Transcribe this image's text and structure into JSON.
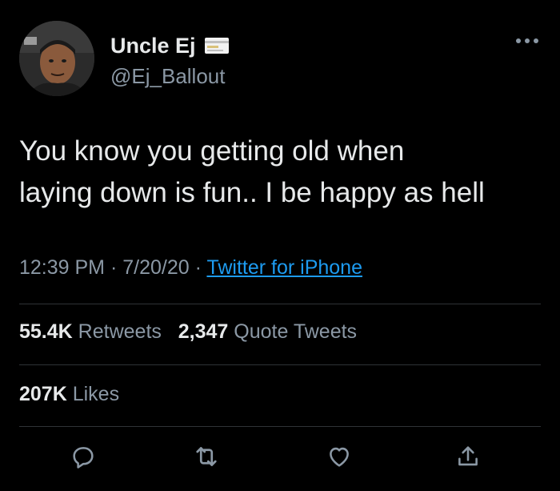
{
  "user": {
    "display_name": "Uncle Ej",
    "handle": "@Ej_Ballout",
    "badge_icon": "card-icon"
  },
  "tweet": {
    "text": "You know you getting old when\nlaying down is fun.. I be happy as hell",
    "time": "12:39 PM",
    "date": "7/20/20",
    "separator": "·",
    "source": "Twitter for iPhone"
  },
  "stats": {
    "retweets_count": "55.4K",
    "retweets_label": "Retweets",
    "quotes_count": "2,347",
    "quotes_label": "Quote Tweets",
    "likes_count": "207K",
    "likes_label": "Likes"
  },
  "actions": {
    "reply_icon": "reply-icon",
    "retweet_icon": "retweet-icon",
    "like_icon": "heart-icon",
    "share_icon": "share-icon"
  },
  "colors": {
    "background": "#000000",
    "text": "#e7e9ea",
    "secondary": "#8b98a5",
    "link": "#1d9bf0",
    "divider": "#2f3336"
  }
}
